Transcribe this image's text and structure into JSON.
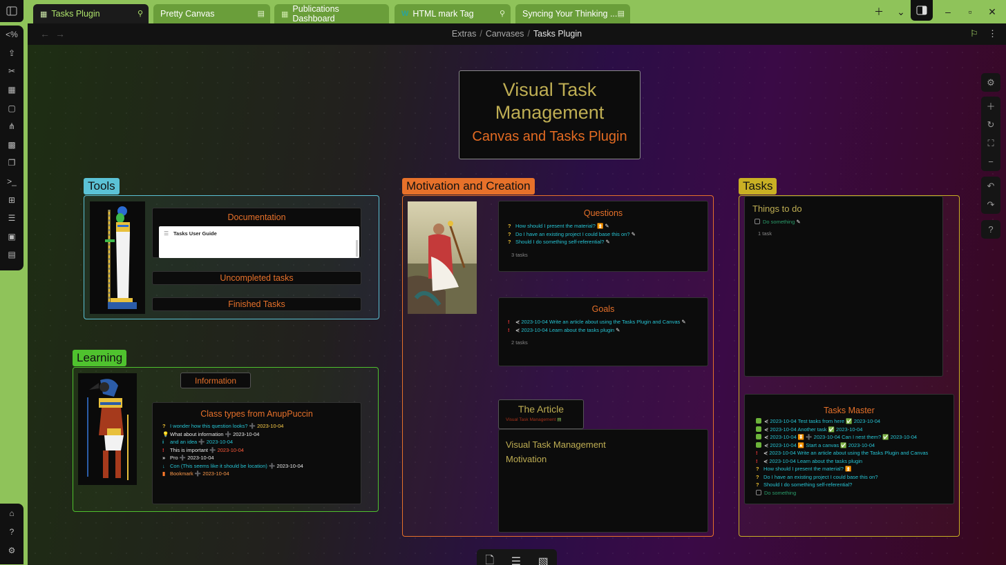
{
  "tabs": [
    {
      "label": "Tasks Plugin",
      "icon": "grid-icon",
      "pinned": true,
      "active": true
    },
    {
      "label": "Pretty Canvas",
      "icon": "",
      "pinned": false,
      "active": false
    },
    {
      "label": "Publications Dashboard",
      "icon": "grid-icon",
      "pinned": false,
      "active": false
    },
    {
      "label": "HTML mark Tag",
      "icon": "w-icon",
      "pinned": true,
      "active": false
    },
    {
      "label": "Syncing Your Thinking ...",
      "icon": "",
      "pinned": false,
      "active": false
    }
  ],
  "breadcrumb": {
    "path": [
      "Extras",
      "Canvases"
    ],
    "current": "Tasks Plugin",
    "separator": "/"
  },
  "hero": {
    "title_line1": "Visual Task",
    "title_line2": "Management",
    "subtitle": "Canvas and Tasks Plugin"
  },
  "groups": {
    "tools": {
      "label": "Tools",
      "color": "#5bc2d6"
    },
    "learning": {
      "label": "Learning",
      "color": "#4fc22e"
    },
    "motivation": {
      "label": "Motivation and Creation",
      "color": "#e7712a"
    },
    "tasks": {
      "label": "Tasks",
      "color": "#c9b024"
    }
  },
  "tools": {
    "documentation": {
      "title": "Documentation",
      "embed_title": "Tasks User Guide"
    },
    "uncompleted": "Uncompleted tasks",
    "finished": "Finished Tasks"
  },
  "learning": {
    "information": "Information",
    "class_types": {
      "title": "Class types from AnupPuccin",
      "items": [
        {
          "marker": "?",
          "text": "I wonder how this question looks?",
          "sep": "➕",
          "date": "2023-10-04"
        },
        {
          "marker": "💡",
          "text": "What about information",
          "sep": "➕",
          "date": "2023-10-04"
        },
        {
          "marker": "i",
          "text": "and an idea",
          "sep": "➕",
          "date": "2023-10-04"
        },
        {
          "marker": "!",
          "text": "This is important",
          "sep": "➕",
          "date": "2023-10-04"
        },
        {
          "marker": "»",
          "text": "Pro",
          "sep": "➕",
          "date": "2023-10-04"
        },
        {
          "marker": "↓",
          "text": "Con (This seems like it should be location)",
          "sep": "➕",
          "date": "2023-10-04"
        },
        {
          "marker": "▮",
          "text": "Bookmark",
          "sep": "➕",
          "date": "2023-10-04"
        }
      ]
    }
  },
  "motivation": {
    "questions": {
      "title": "Questions",
      "items": [
        {
          "marker": "?",
          "text": "How should I present the material? ⏫"
        },
        {
          "marker": "?",
          "text": "Do I have an existing project I could base this on?"
        },
        {
          "marker": "?",
          "text": "Should I do something self-referential?"
        }
      ],
      "count": "3 tasks"
    },
    "goals": {
      "title": "Goals",
      "items": [
        {
          "marker": "!",
          "text": "2023-10-04 Write an article about using the Tasks Plugin and Canvas"
        },
        {
          "marker": "!",
          "text": "2023-10-04 Learn about the tasks plugin"
        }
      ],
      "count": "2 tasks"
    },
    "article": {
      "title": "The Article",
      "link": "Visual Task Management"
    },
    "article_body": {
      "line1": "Visual Task Management",
      "line2": "Motivation"
    }
  },
  "tasks": {
    "todo": {
      "title": "Things to do",
      "item": "Do something",
      "count": "1 task"
    },
    "master": {
      "title": "Tasks Master",
      "items": [
        {
          "state": "done",
          "text": "2023-10-04 Test tasks from here ✅ 2023-10-04"
        },
        {
          "state": "done",
          "text": "2023-10-04 Another task ✅ 2023-10-04"
        },
        {
          "state": "done",
          "text": "2023-10-04 ⏬ ➕ 2023-10-04 Can I nest them? ✅ 2023-10-04"
        },
        {
          "state": "done",
          "text": "2023-10-04 🔼 Start a canvas ✅ 2023-10-04"
        },
        {
          "state": "important",
          "text": "2023-10-04 Write an article about using the Tasks Plugin and Canvas"
        },
        {
          "state": "important",
          "text": "2023-10-04 Learn about the tasks plugin"
        },
        {
          "state": "question",
          "text": "How should I present the material? ⏫"
        },
        {
          "state": "question",
          "text": "Do I have an existing project I could base this on?"
        },
        {
          "state": "question",
          "text": "Should I do something self-referential?"
        },
        {
          "state": "open",
          "text": "Do something"
        }
      ]
    }
  }
}
